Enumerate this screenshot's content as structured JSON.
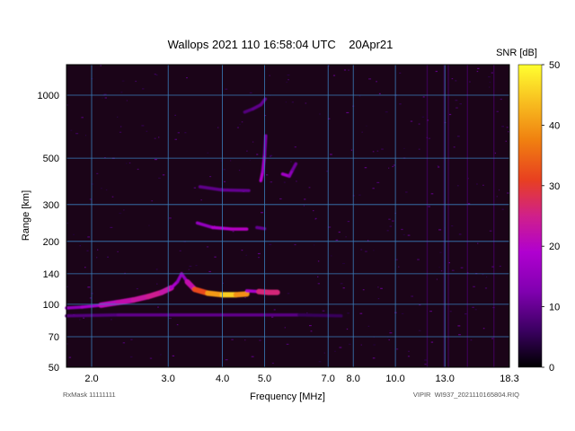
{
  "chart_data": {
    "type": "heatmap",
    "title": "Wallops 2021 110 16:58:04 UTC    20Apr21",
    "xlabel": "Frequency [MHz]",
    "ylabel": "Range [km]",
    "x_scale": "log",
    "y_scale": "log",
    "xlim": [
      1.75,
      18.3
    ],
    "ylim": [
      50,
      1400
    ],
    "x_ticks": [
      2.0,
      3.0,
      4.0,
      5.0,
      7.0,
      8.0,
      10.0,
      13.0,
      18.3
    ],
    "x_tick_labels": [
      "2.0",
      "3.0",
      "4.0",
      "5.0",
      "7.0",
      "8.0",
      "10.0",
      "13.0",
      "18.3"
    ],
    "y_ticks": [
      50,
      70,
      100,
      140,
      200,
      300,
      500,
      1000
    ],
    "y_tick_labels": [
      "50",
      "70",
      "100",
      "140",
      "200",
      "300",
      "500",
      "1000"
    ],
    "grid": true,
    "colorbar": {
      "label": "SNR [dB]",
      "range": [
        0,
        50
      ],
      "ticks": [
        0,
        10,
        20,
        30,
        40,
        50
      ],
      "colors": [
        "#000000",
        "#3a0060",
        "#8000b0",
        "#b000d0",
        "#d0208a",
        "#e84020",
        "#f08010",
        "#f8c020",
        "#ffff30"
      ]
    },
    "background_color": "#1b0418",
    "traces": [
      {
        "points": [
          [
            1.75,
            96,
            14
          ],
          [
            1.9,
            97,
            16
          ],
          [
            2.1,
            99,
            19
          ],
          [
            2.3,
            102,
            22
          ],
          [
            2.5,
            105,
            22
          ],
          [
            2.7,
            109,
            24
          ],
          [
            2.9,
            114,
            25
          ],
          [
            3.05,
            120,
            20
          ],
          [
            3.15,
            128,
            16
          ],
          [
            3.22,
            140,
            14
          ]
        ]
      },
      {
        "points": [
          [
            3.22,
            140,
            14
          ],
          [
            3.32,
            128,
            16
          ],
          [
            3.45,
            118,
            28
          ],
          [
            3.7,
            113,
            36
          ],
          [
            4.0,
            111,
            44
          ],
          [
            4.3,
            111,
            46
          ],
          [
            4.55,
            112,
            32
          ]
        ]
      },
      {
        "points": [
          [
            4.55,
            116,
            12
          ],
          [
            4.85,
            115,
            24
          ],
          [
            5.1,
            114,
            28
          ],
          [
            5.35,
            114,
            24
          ]
        ]
      },
      {
        "points": [
          [
            1.75,
            88,
            8
          ],
          [
            2.3,
            89,
            9
          ],
          [
            3.0,
            89,
            10
          ],
          [
            4.0,
            89,
            9
          ],
          [
            5.0,
            89,
            10
          ],
          [
            6.0,
            89,
            8
          ],
          [
            7.5,
            88,
            4
          ]
        ]
      },
      {
        "points": [
          [
            3.5,
            245,
            14
          ],
          [
            3.8,
            233,
            16
          ],
          [
            4.2,
            229,
            22
          ],
          [
            4.55,
            229,
            18
          ]
        ]
      },
      {
        "points": [
          [
            4.8,
            233,
            10
          ],
          [
            5.0,
            230,
            10
          ]
        ]
      },
      {
        "points": [
          [
            3.55,
            365,
            9
          ],
          [
            4.0,
            352,
            10
          ],
          [
            4.6,
            350,
            10
          ]
        ]
      },
      {
        "points": [
          [
            4.9,
            390,
            20
          ],
          [
            4.95,
            430,
            18
          ],
          [
            5.0,
            520,
            14
          ],
          [
            5.03,
            640,
            10
          ]
        ]
      },
      {
        "points": [
          [
            5.5,
            420,
            18
          ],
          [
            5.7,
            410,
            16
          ],
          [
            5.8,
            440,
            12
          ],
          [
            5.9,
            470,
            10
          ]
        ]
      },
      {
        "points": [
          [
            4.5,
            830,
            8
          ],
          [
            4.7,
            860,
            9
          ],
          [
            4.9,
            900,
            10
          ],
          [
            5.02,
            960,
            10
          ]
        ]
      }
    ]
  },
  "footer": {
    "rxmask": "RxMask 11111111",
    "file": "VIPIR  WI937_2021110165804.RIQ"
  }
}
